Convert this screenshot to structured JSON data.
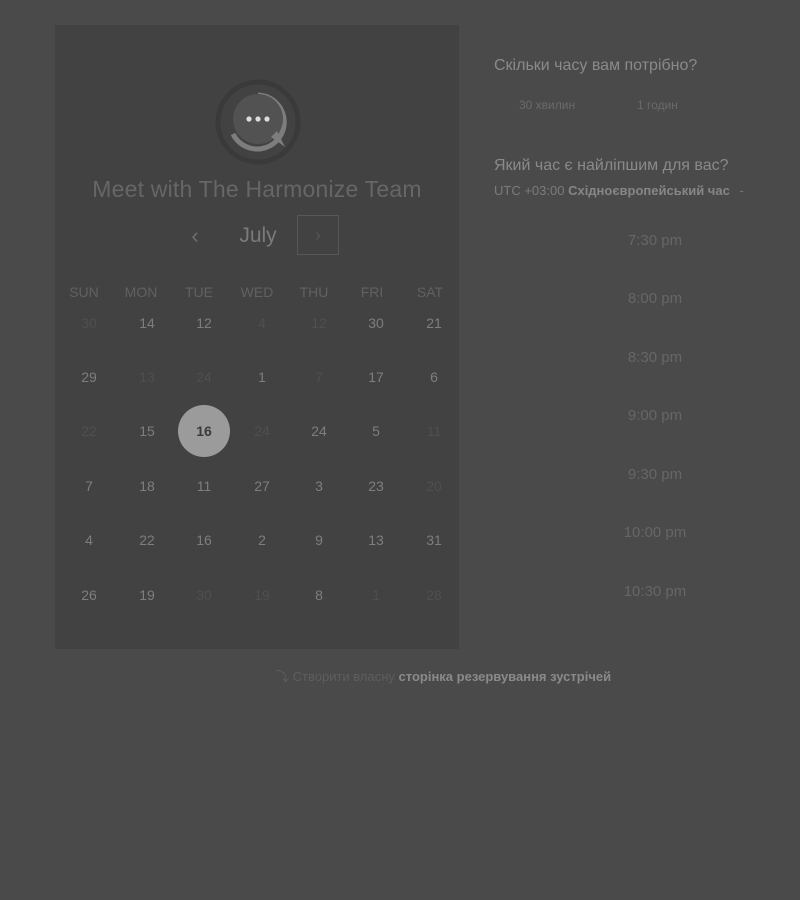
{
  "calendar": {
    "title": "Meet with The Harmonize Team",
    "month": "July",
    "prev_icon": "‹",
    "next_icon": "›",
    "weekdays": [
      "SUN",
      "MON",
      "TUE",
      "WED",
      "THU",
      "FRI",
      "SAT"
    ],
    "weeks": [
      [
        {
          "d": "30",
          "muted": true
        },
        {
          "d": "14",
          "muted": false
        },
        {
          "d": "12",
          "muted": false
        },
        {
          "d": "4",
          "muted": true
        },
        {
          "d": "12",
          "muted": true
        },
        {
          "d": "30",
          "muted": false
        },
        {
          "d": "21",
          "muted": false
        }
      ],
      [
        {
          "d": "29",
          "muted": false
        },
        {
          "d": "13",
          "muted": true
        },
        {
          "d": "24",
          "muted": true
        },
        {
          "d": "1",
          "muted": false
        },
        {
          "d": "7",
          "muted": true
        },
        {
          "d": "17",
          "muted": false
        },
        {
          "d": "6",
          "muted": false
        }
      ],
      [
        {
          "d": "22",
          "muted": true
        },
        {
          "d": "15",
          "muted": false
        },
        {
          "d": "16",
          "muted": false,
          "selected": true
        },
        {
          "d": "24",
          "muted": true
        },
        {
          "d": "24",
          "muted": false
        },
        {
          "d": "5",
          "muted": false
        },
        {
          "d": "11",
          "muted": true
        }
      ],
      [
        {
          "d": "7",
          "muted": false
        },
        {
          "d": "18",
          "muted": false
        },
        {
          "d": "11",
          "muted": false
        },
        {
          "d": "27",
          "muted": false
        },
        {
          "d": "3",
          "muted": false
        },
        {
          "d": "23",
          "muted": false
        },
        {
          "d": "20",
          "muted": true
        }
      ],
      [
        {
          "d": "4",
          "muted": false
        },
        {
          "d": "22",
          "muted": false
        },
        {
          "d": "16",
          "muted": false
        },
        {
          "d": "2",
          "muted": false
        },
        {
          "d": "9",
          "muted": false
        },
        {
          "d": "13",
          "muted": false
        },
        {
          "d": "31",
          "muted": false
        }
      ],
      [
        {
          "d": "26",
          "muted": false
        },
        {
          "d": "19",
          "muted": false
        },
        {
          "d": "30",
          "muted": true
        },
        {
          "d": "19",
          "muted": true
        },
        {
          "d": "8",
          "muted": false
        },
        {
          "d": "1",
          "muted": true
        },
        {
          "d": "28",
          "muted": true
        }
      ]
    ]
  },
  "booking": {
    "duration_heading": "Скільки часу вам потрібно?",
    "durations": [
      "30 хвилин",
      "1 годин"
    ],
    "time_heading": "Який час є найліпшим для вас?",
    "timezone_offset": "UTC +03:00",
    "timezone_name": "Східноєвропейський час",
    "timezone_caret": "-",
    "slots": [
      "7:30 pm",
      "8:00 pm",
      "8:30 pm",
      "9:00 pm",
      "9:30 pm",
      "10:00 pm",
      "10:30 pm"
    ]
  },
  "footer": {
    "icon": "⤵",
    "prefix": "Створити власну",
    "link": "сторінка резервування зустрічей"
  }
}
